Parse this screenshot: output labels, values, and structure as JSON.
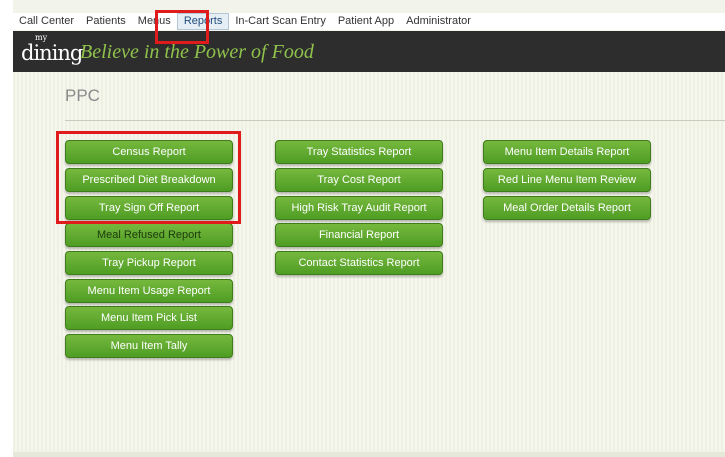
{
  "nav": {
    "items": [
      "Call Center",
      "Patients",
      "Menus",
      "Reports",
      "In-Cart Scan Entry",
      "Patient App",
      "Administrator"
    ]
  },
  "header": {
    "logo_my": "my",
    "logo_dining": "dining",
    "tagline": "Believe in the Power of Food"
  },
  "page": {
    "title": "PPC"
  },
  "reports": {
    "col1": [
      "Census Report",
      "Prescribed Diet Breakdown",
      "Tray Sign Off Report",
      "Meal Refused Report",
      "Tray Pickup Report",
      "Menu Item Usage Report",
      "Menu Item Pick List",
      "Menu Item Tally"
    ],
    "col2": [
      "Tray Statistics Report",
      "Tray Cost Report",
      "High Risk Tray Audit Report",
      "Financial Report",
      "Contact Statistics Report"
    ],
    "col3": [
      "Menu Item Details Report",
      "Red Line Menu Item Review",
      "Meal Order Details Report"
    ]
  },
  "colors": {
    "button_green": "#5ea82d",
    "header_bg": "#2d2d2d",
    "tagline": "#8fc24b",
    "highlight_red": "#e01b1b"
  }
}
